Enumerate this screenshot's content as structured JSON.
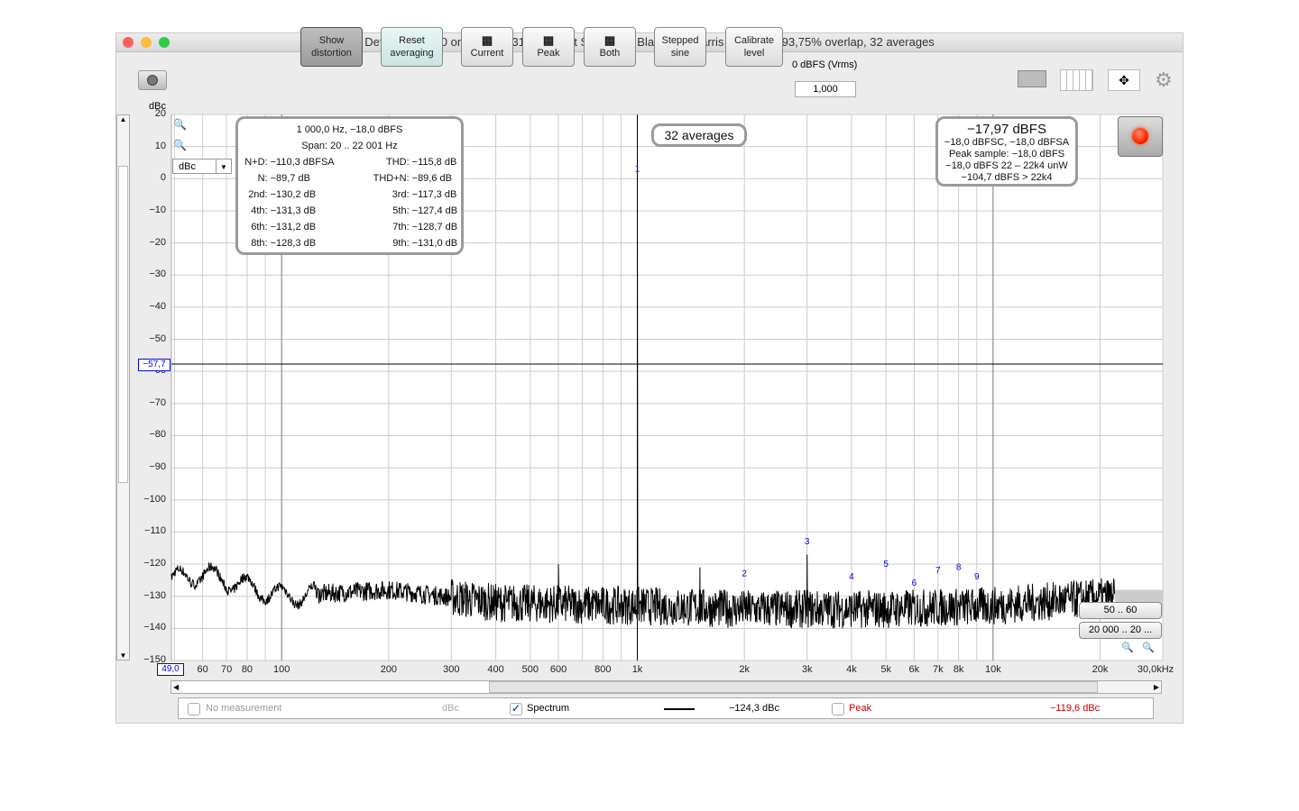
{
  "window": {
    "title": "Default Input 10 on 828ES 131 072-point Spectrum, Blackman-Harris 7 window, 93,75% overlap, 32 averages"
  },
  "toolbar": {
    "show_distortion": [
      "Show",
      "distortion"
    ],
    "reset_averaging": [
      "Reset",
      "averaging"
    ],
    "current": "Current",
    "peak": "Peak",
    "both": "Both",
    "stepped_sine": [
      "Stepped",
      "sine"
    ],
    "calibrate_level": [
      "Calibrate",
      "level"
    ],
    "dbfs_label": "0 dBFS (Vrms)",
    "dbfs_value": "1,000",
    "icons": [
      "camera-icon",
      "layout-icon",
      "columns-icon",
      "move-arrows-icon",
      "gear-icon"
    ]
  },
  "unit_select": "dBc",
  "distortion_box": {
    "title": "1 000,0 Hz, −18,0 dBFS",
    "span": "Span: 20 .. 22 001 Hz",
    "rows": [
      [
        "N+D:",
        "−110,3 dBFSA",
        "THD:",
        "−115,8 dB"
      ],
      [
        "N:",
        "−89,7 dB",
        "THD+N:",
        "−89,6 dB"
      ],
      [
        "2nd:",
        "−130,2 dB",
        "3rd:",
        "−117,3 dB"
      ],
      [
        "4th:",
        "−131,3 dB",
        "5th:",
        "−127,4 dB"
      ],
      [
        "6th:",
        "−131,2 dB",
        "7th:",
        "−128,7 dB"
      ],
      [
        "8th:",
        "−128,3 dB",
        "9th:",
        "−131,0 dB"
      ]
    ]
  },
  "averages_badge": "32 averages",
  "level_box": {
    "main": "−17,97 dBFS",
    "lines": [
      "−18,0 dBFSC, −18,0 dBFSA",
      "Peak sample: −18,0 dBFS",
      "−18,0 dBFS 22 – 22k4 unW",
      "−104,7 dBFS > 22k4"
    ]
  },
  "range_buttons": [
    "50 .. 60",
    "20 000 .. 20 ..."
  ],
  "cursor": {
    "y_readout": "−57,7",
    "x_readout": "49,0"
  },
  "legend": {
    "no_measurement": "No measurement",
    "no_measurement_unit": "dBc",
    "spectrum": "Spectrum",
    "spectrum_value": "−124,3 dBc",
    "peak": "Peak",
    "peak_value": "−119,6 dBc",
    "spectrum_checked": true,
    "peak_checked": false,
    "peak_color": "#cc0000"
  },
  "colors": {
    "trace": "#000000",
    "marker": "#0000ee",
    "record": "#ff2a00"
  },
  "chart_data": {
    "type": "line",
    "xscale": "log",
    "xlim": [
      49,
      30000
    ],
    "ylim": [
      -150,
      20
    ],
    "ylabel": "dBc",
    "grid": true,
    "yticks": [
      "20",
      "10",
      "0",
      "−10",
      "−20",
      "−30",
      "−40",
      "−50",
      "−60",
      "−70",
      "−80",
      "−90",
      "−100",
      "−110",
      "−120",
      "−130",
      "−140",
      "−150"
    ],
    "xticks": [
      {
        "v": 60,
        "l": "60"
      },
      {
        "v": 70,
        "l": "70"
      },
      {
        "v": 80,
        "l": "80"
      },
      {
        "v": 100,
        "l": "100"
      },
      {
        "v": 200,
        "l": "200"
      },
      {
        "v": 300,
        "l": "300"
      },
      {
        "v": 400,
        "l": "400"
      },
      {
        "v": 500,
        "l": "500"
      },
      {
        "v": 600,
        "l": "600"
      },
      {
        "v": 800,
        "l": "800"
      },
      {
        "v": 1000,
        "l": "1k"
      },
      {
        "v": 2000,
        "l": "2k"
      },
      {
        "v": 3000,
        "l": "3k"
      },
      {
        "v": 4000,
        "l": "4k"
      },
      {
        "v": 5000,
        "l": "5k"
      },
      {
        "v": 6000,
        "l": "6k"
      },
      {
        "v": 7000,
        "l": "7k"
      },
      {
        "v": 8000,
        "l": "8k"
      },
      {
        "v": 10000,
        "l": "10k"
      },
      {
        "v": 20000,
        "l": "20k"
      },
      {
        "v": 30000,
        "l": "30,0kHz"
      }
    ],
    "noise_floor": [
      [
        49,
        -125
      ],
      [
        60,
        -123
      ],
      [
        100,
        -130
      ],
      [
        200,
        -128
      ],
      [
        400,
        -132
      ],
      [
        1000,
        -133
      ],
      [
        2000,
        -134
      ],
      [
        5000,
        -134
      ],
      [
        10000,
        -133
      ],
      [
        22000,
        -130
      ],
      [
        30000,
        -128
      ]
    ],
    "peaks": [
      [
        1000,
        0
      ],
      [
        600,
        -120
      ],
      [
        1500,
        -121
      ],
      [
        3000,
        -117
      ]
    ],
    "harmonic_markers": [
      {
        "label": "1",
        "f": 1000,
        "db": 0
      },
      {
        "label": "2",
        "f": 2000,
        "db": -126
      },
      {
        "label": "3",
        "f": 3000,
        "db": -116
      },
      {
        "label": "4",
        "f": 4000,
        "db": -127
      },
      {
        "label": "5",
        "f": 5000,
        "db": -123
      },
      {
        "label": "6",
        "f": 6000,
        "db": -129
      },
      {
        "label": "7",
        "f": 7000,
        "db": -125
      },
      {
        "label": "8",
        "f": 8000,
        "db": -124
      },
      {
        "label": "9",
        "f": 9000,
        "db": -127
      }
    ],
    "cursor_db": -57.7,
    "cursor_f": 1000
  }
}
